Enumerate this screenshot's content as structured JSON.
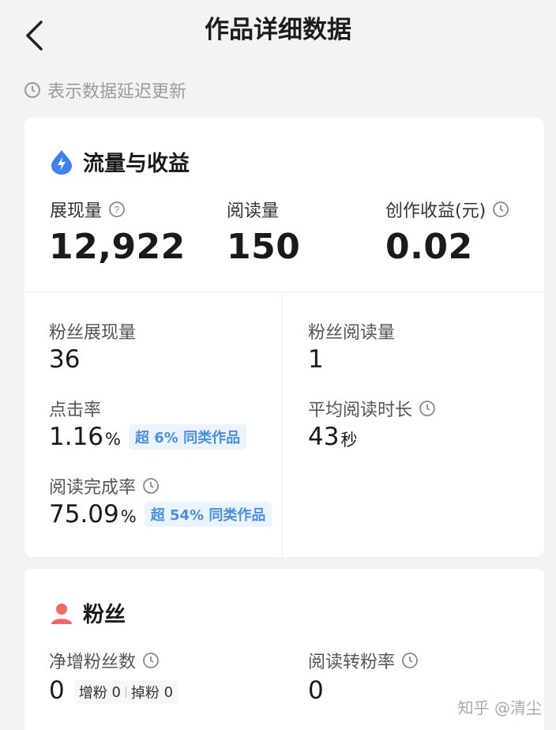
{
  "header": {
    "title": "作品详细数据"
  },
  "notice": {
    "text": "表示数据延迟更新"
  },
  "traffic": {
    "title": "流量与收益",
    "impressions": {
      "label": "展现量",
      "value": "12,922"
    },
    "reads": {
      "label": "阅读量",
      "value": "150"
    },
    "earnings": {
      "label": "创作收益(元)",
      "value": "0.02"
    },
    "fan_impressions": {
      "label": "粉丝展现量",
      "value": "36"
    },
    "fan_reads": {
      "label": "粉丝阅读量",
      "value": "1"
    },
    "ctr": {
      "label": "点击率",
      "value": "1.16",
      "unit": "%",
      "badge": "超 6% 同类作品"
    },
    "avg_read_time": {
      "label": "平均阅读时长",
      "value": "43",
      "unit": "秒"
    },
    "completion": {
      "label": "阅读完成率",
      "value": "75.09",
      "unit": "%",
      "badge": "超 54% 同类作品"
    }
  },
  "fans": {
    "title": "粉丝",
    "net_growth": {
      "label": "净增粉丝数",
      "value": "0",
      "gain_label": "增粉",
      "gain_value": "0",
      "loss_label": "掉粉",
      "loss_value": "0"
    },
    "conversion": {
      "label": "阅读转粉率",
      "value": "0"
    }
  },
  "watermark": "知乎 @清尘",
  "colors": {
    "accent": "#4a8fe0",
    "fans_icon": "#f06a6a",
    "muted": "#9a9a9a"
  }
}
